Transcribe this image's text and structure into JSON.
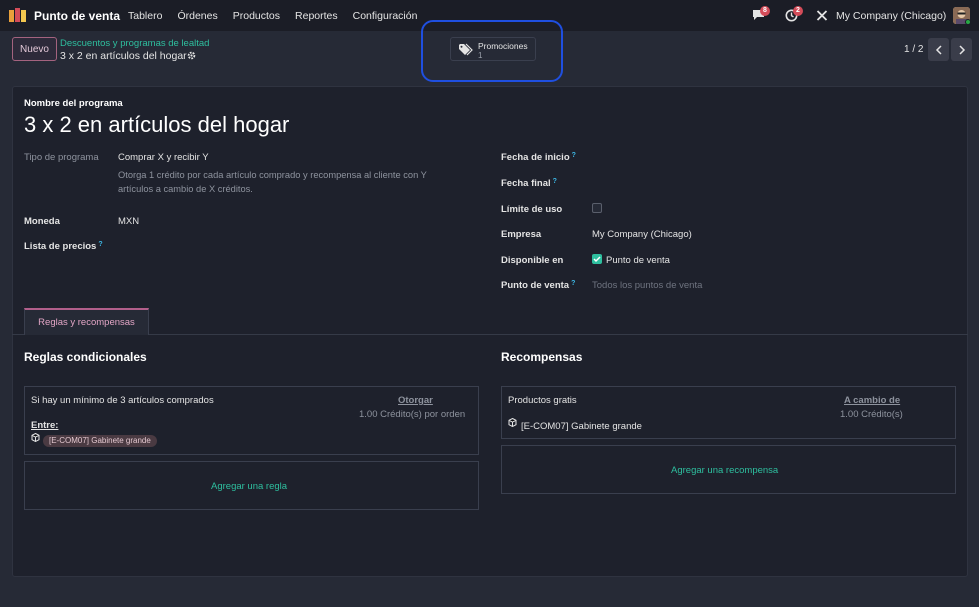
{
  "navbar": {
    "app_name": "Punto de venta",
    "menu": [
      "Tablero",
      "Órdenes",
      "Productos",
      "Reportes",
      "Configuración"
    ],
    "messages_count": "8",
    "activities_count": "2",
    "company": "My Company (Chicago)"
  },
  "control_panel": {
    "new_label": "Nuevo",
    "breadcrumb_parent": "Descuentos y programas de lealtad",
    "breadcrumb_current": "3 x 2 en artículos del hogar",
    "smart_button": {
      "label": "Promociones",
      "count": "1"
    },
    "pager": "1 / 2"
  },
  "form": {
    "program_name_label": "Nombre del programa",
    "program_name": "3 x 2 en artículos del hogar",
    "left": {
      "program_type_label": "Tipo de programa",
      "program_type": "Comprar X y recibir Y",
      "program_type_desc_1": "Otorga 1 crédito por cada artículo comprado y recompensa al cliente con Y",
      "program_type_desc_2": "artículos a cambio de X créditos.",
      "currency_label": "Moneda",
      "currency": "MXN",
      "pricelist_label": "Lista de precios",
      "help_mark": "?"
    },
    "right": {
      "start_date_label": "Fecha de inicio",
      "end_date_label": "Fecha final",
      "usage_limit_label": "Límite de uso",
      "company_label": "Empresa",
      "company": "My Company (Chicago)",
      "available_label": "Disponible en",
      "available_value": "Punto de venta",
      "pos_label": "Punto de venta",
      "pos_placeholder": "Todos los puntos de venta"
    },
    "tab_label": "Reglas y recompensas",
    "rules": {
      "title": "Reglas condicionales",
      "rule_text": "Si hay un mínimo de 3 artículos comprados",
      "grant_label": "Otorgar",
      "grant_value": "1.00 Crédito(s) por orden",
      "among_label": "Entre:",
      "product_chip": "[E-COM07] Gabinete grande",
      "add_rule": "Agregar una regla"
    },
    "rewards": {
      "title": "Recompensas",
      "reward_text": "Productos gratis",
      "exchange_label": "A cambio de",
      "exchange_value": "1.00 Crédito(s)",
      "product": "[E-COM07] Gabinete grande",
      "add_reward": "Agregar una recompensa"
    }
  }
}
